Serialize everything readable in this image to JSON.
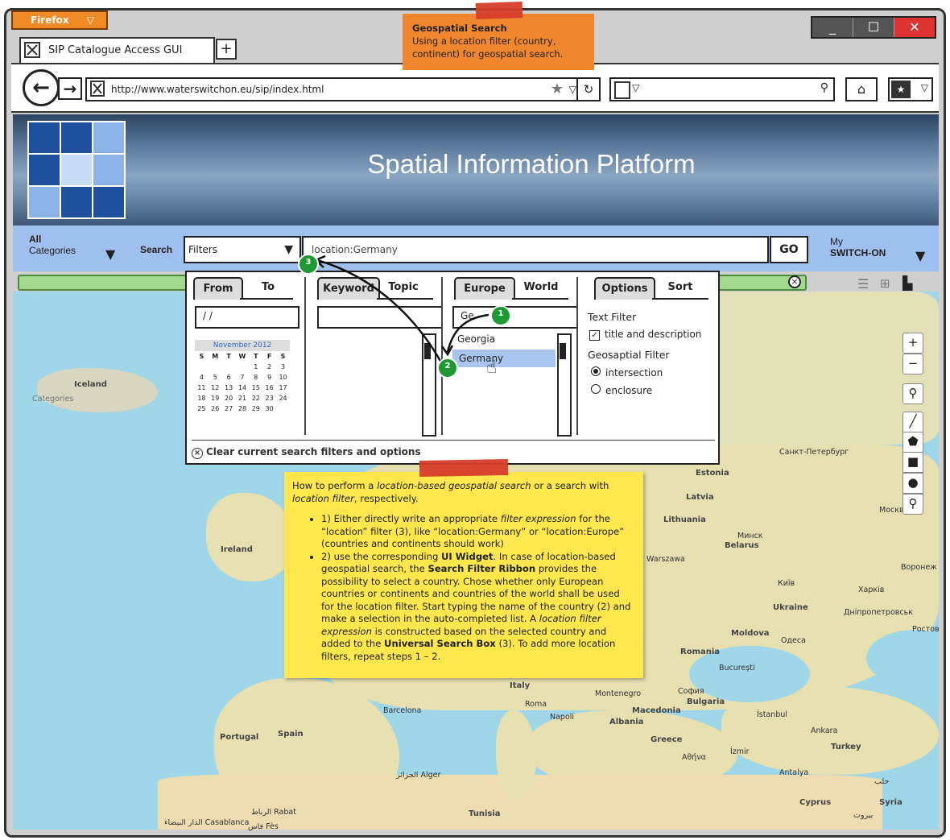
{
  "browser": {
    "menu_button": "Firefox",
    "tab_title": "SIP Catalogue Access GUI",
    "new_tab": "+",
    "url": "http://www.waterswitchon.eu/sip/index.html",
    "window_controls": [
      "_",
      "☐",
      "✕"
    ]
  },
  "banner": {
    "title": "Spatial Information Platform"
  },
  "toolbar": {
    "categories_line1": "All",
    "categories_line2": "Categories",
    "search_label": "Search",
    "filter_select": "Filters",
    "query_value": "location:Germany",
    "go_label": "GO",
    "account_line1": "My",
    "account_line2": "SWITCH-ON"
  },
  "filter_panel": {
    "date": {
      "tab_from": "From",
      "tab_to": "To",
      "date_value": "/ /",
      "calendar_month": "November 2012",
      "weekdays": [
        "S",
        "M",
        "T",
        "W",
        "T",
        "F",
        "S"
      ],
      "weeks": [
        [
          "",
          "",
          "",
          "",
          "1",
          "2",
          "3"
        ],
        [
          "4",
          "5",
          "6",
          "7",
          "8",
          "9",
          "10"
        ],
        [
          "11",
          "12",
          "13",
          "14",
          "15",
          "16",
          "17"
        ],
        [
          "18",
          "19",
          "20",
          "21",
          "22",
          "23",
          "24"
        ],
        [
          "25",
          "26",
          "27",
          "28",
          "29",
          "30",
          ""
        ]
      ]
    },
    "text": {
      "tab_keyword": "Keyword",
      "tab_topic": "Topic"
    },
    "location": {
      "tab_europe": "Europe",
      "tab_world": "World",
      "input_value": "Ge",
      "suggestions": [
        "Georgia",
        "Germany"
      ]
    },
    "options": {
      "tab_options": "Options",
      "tab_sort": "Sort",
      "text_filter_label": "Text Filter",
      "text_filter_option": "title and description",
      "geo_filter_label": "Geosaptial Filter",
      "geo_option_1": "intersection",
      "geo_option_2": "enclosure"
    },
    "clear_label": "Clear current search filters and options"
  },
  "markers": {
    "m1": "1",
    "m2": "2",
    "m3": "3"
  },
  "top_note": {
    "title": "Geospatial Search",
    "line1": "Using a location filter (country,",
    "line2": "continent) for geospatial search."
  },
  "note": {
    "intro_1": "How to perform a ",
    "intro_em1": "location-based geospatial search",
    "intro_2": " or a search with ",
    "intro_em2": "location filter",
    "intro_3": ", respectively.",
    "b1_1": "1) Either directly write an appropriate ",
    "b1_em": "filter expression",
    "b1_2": " for the “location” filter (3), like “location:Germany” or “location:Europe” (countries and continents should work)",
    "b2_1": "2) use the corresponding ",
    "b2_b1": "UI Widget",
    "b2_2": ". In case of location-based geospatial search, the ",
    "b2_b2": "Search Filter Ribbon",
    "b2_3": " provides the possibility to select a country. Chose whether only European countries or continents and countries of the world shall be used for the location filter. Start typing the name of the country (2) and make a selection in the auto-completed list. A ",
    "b2_em": "location filter expression",
    "b2_4": " is constructed based on the selected country and added to the ",
    "b2_b3": "Universal Search Box",
    "b2_5": " (3). To add more location filters, repeat steps 1 – 2."
  },
  "map": {
    "zoom_in": "+",
    "zoom_out": "−",
    "labels": {
      "iceland": "Iceland",
      "ireland": "Ireland",
      "portugal": "Portugal",
      "spain": "Spain",
      "estonia": "Estonia",
      "latvia": "Latvia",
      "lithuania": "Lithuania",
      "belarus": "Belarus",
      "ukraine": "Ukraine",
      "moldova": "Moldova",
      "romania": "Romania",
      "bulgaria": "Bulgaria",
      "macedonia": "Macedonia",
      "albania": "Albania",
      "greece": "Greece",
      "turkey": "Turkey",
      "italy": "Italy",
      "syria": "Syria",
      "cyprus": "Cyprus",
      "tunisia": "Tunisia",
      "montenegro": "Montenegro",
      "spb": "Санкт-Петербург",
      "moscow": "Москва",
      "minsk": "Минск",
      "warsaw": "Warszawa",
      "kyiv": "Київ",
      "kharkiv": "Харків",
      "voronezh": "Воронеж",
      "dnipro": "Дніпропетровськ",
      "rostov": "Ростов",
      "odessa": "Одеса",
      "bucuresti": "București",
      "sofia": "София",
      "istanbul": "İstanbul",
      "ankara": "Ankara",
      "izmir": "İzmir",
      "athens": "Αθήνα",
      "antalya": "Antalya",
      "barcelona": "Barcelona",
      "roma": "Roma",
      "napoli": "Napoli",
      "algiers": "الجزائر Alger",
      "rabat": "الرباط Rabat",
      "casablanca": "الدار البيضاء Casablanca",
      "fes": "فاس Fès",
      "halab": "حلب",
      "beirut": "بيروت",
      "categories": "Categories"
    }
  },
  "colors": {
    "toolbar": "#9fbfef",
    "note": "#fde74c",
    "top_note": "#f0872f",
    "marker": "#1f9a32",
    "selection": "#a9c4ef"
  }
}
